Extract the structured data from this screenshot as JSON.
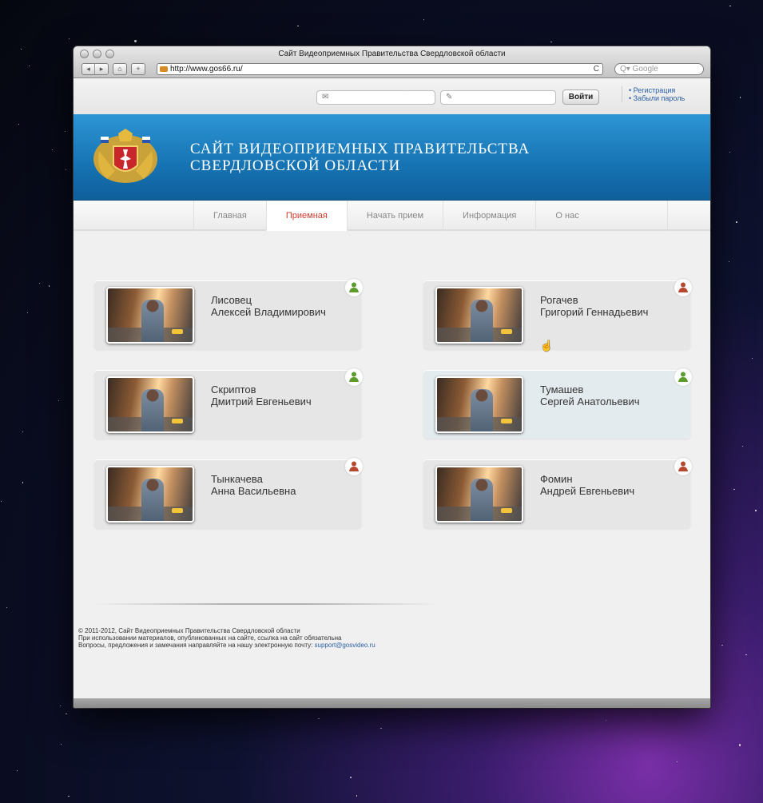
{
  "browser": {
    "window_title": "Сайт Видеоприемных Правительства Свердловской области",
    "url": "http://www.gos66.ru/",
    "search_placeholder": "Google",
    "back": "◂",
    "forward": "▸",
    "home": "⌂",
    "add": "+",
    "reload": "C"
  },
  "auth": {
    "login_button": "Войти",
    "register_link": "Регистрация",
    "forgot_link": "Забыли пароль"
  },
  "header": {
    "title": "САЙТ ВИДЕОПРИЕМНЫХ ПРАВИТЕЛЬСТВА\nСВЕРДЛОВСКОЙ ОБЛАСТИ"
  },
  "menu": {
    "items": [
      {
        "label": "Главная",
        "active": false
      },
      {
        "label": "Приемная",
        "active": true
      },
      {
        "label": "Начать прием",
        "active": false
      },
      {
        "label": "Информация",
        "active": false
      },
      {
        "label": "О нас",
        "active": false
      }
    ]
  },
  "officials": [
    {
      "surname": "Лисовец",
      "given": "Алексей Владимирович",
      "status": "online",
      "status_color": "#5d9b2c"
    },
    {
      "surname": "Рогачев",
      "given": "Григорий Геннадьевич",
      "status": "busy",
      "status_color": "#b5482e"
    },
    {
      "surname": "Скриптов",
      "given": "Дмитрий Евгеньевич",
      "status": "online",
      "status_color": "#5d9b2c"
    },
    {
      "surname": "Тумашев",
      "given": "Сергей Анатольевич",
      "status": "online",
      "status_color": "#5d9b2c"
    },
    {
      "surname": "Тынкачева",
      "given": "Анна Васильевна",
      "status": "busy",
      "status_color": "#b5482e"
    },
    {
      "surname": "Фомин",
      "given": "Андрей Евгеньевич",
      "status": "busy",
      "status_color": "#b5482e"
    }
  ],
  "footer": {
    "copyright": "© 2011-2012, Сайт Видеоприемных Правительства Свердловской области",
    "line2": "При использовании материалов, опубликованных на сайте, ссылка на сайт обязательна",
    "line3": "Вопросы, предложения и замечания направляйте на нашу электронную почту:",
    "email": "support@gosvideo.ru"
  }
}
